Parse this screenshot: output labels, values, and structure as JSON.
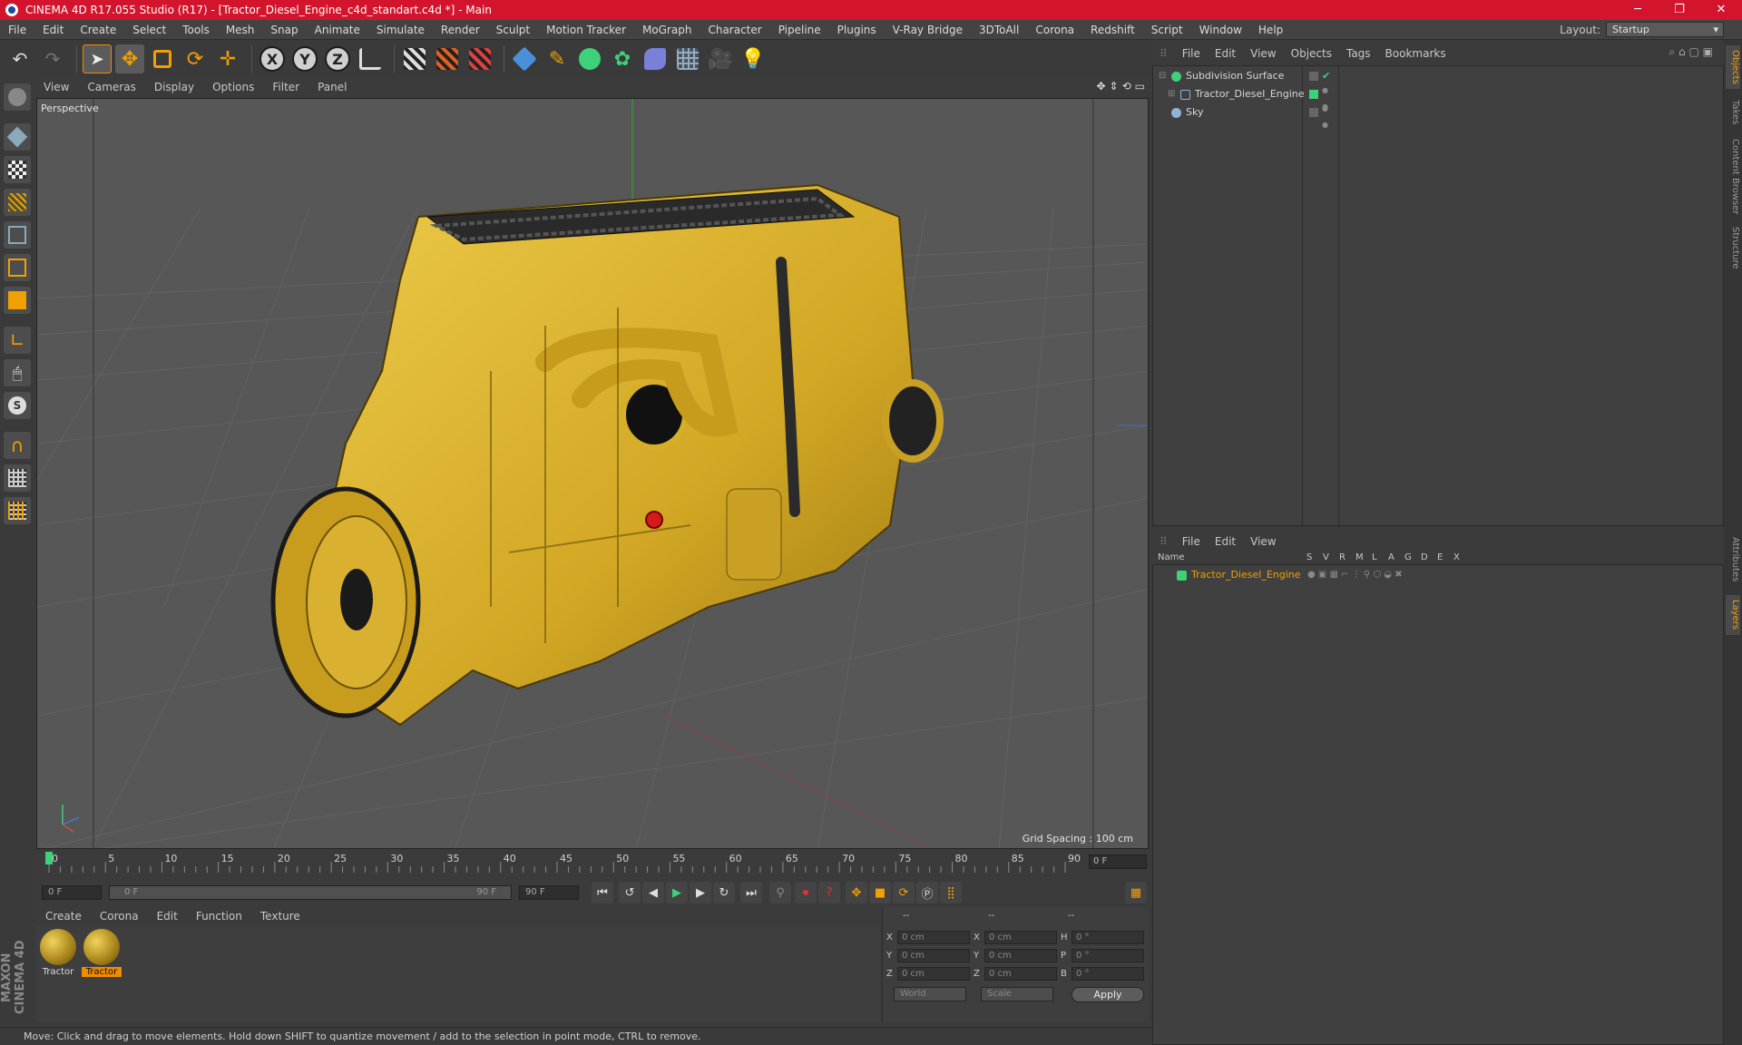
{
  "window": {
    "title": "CINEMA 4D R17.055 Studio (R17) - [Tractor_Diesel_Engine_c4d_standart.c4d *] - Main",
    "minimize": "─",
    "maximize": "❐",
    "close": "✕"
  },
  "menu": [
    "File",
    "Edit",
    "Create",
    "Select",
    "Tools",
    "Mesh",
    "Snap",
    "Animate",
    "Simulate",
    "Render",
    "Sculpt",
    "Motion Tracker",
    "MoGraph",
    "Character",
    "Pipeline",
    "Plugins",
    "V-Ray Bridge",
    "3DToAll",
    "Corona",
    "Redshift",
    "Script",
    "Window",
    "Help"
  ],
  "layout": {
    "label": "Layout:",
    "value": "Startup"
  },
  "viewport": {
    "menu": [
      "View",
      "Cameras",
      "Display",
      "Options",
      "Filter",
      "Panel"
    ],
    "camera_label": "Perspective",
    "grid_spacing": "Grid Spacing : 100 cm"
  },
  "timeline": {
    "ticks": [
      "0",
      "5",
      "10",
      "15",
      "20",
      "25",
      "30",
      "35",
      "40",
      "45",
      "50",
      "55",
      "60",
      "65",
      "70",
      "75",
      "80",
      "85",
      "90"
    ],
    "current_frame": "0 F",
    "start_field": "0 F",
    "range_start": "0 F",
    "range_end": "90 F",
    "end_field": "90 F"
  },
  "material_manager": {
    "menu": [
      "Create",
      "Corona",
      "Edit",
      "Function",
      "Texture"
    ],
    "materials": [
      {
        "label": "Tractor",
        "selected": false
      },
      {
        "label": "Tractor",
        "selected": true
      }
    ]
  },
  "coordinates": {
    "headers": [
      "--",
      "--",
      "--"
    ],
    "rows": [
      {
        "axis1": "X",
        "val1": "0 cm",
        "axis2": "X",
        "val2": "0 cm",
        "axis3": "H",
        "val3": "0 °"
      },
      {
        "axis1": "Y",
        "val1": "0 cm",
        "axis2": "Y",
        "val2": "0 cm",
        "axis3": "P",
        "val3": "0 °"
      },
      {
        "axis1": "Z",
        "val1": "0 cm",
        "axis2": "Z",
        "val2": "0 cm",
        "axis3": "B",
        "val3": "0 °"
      }
    ],
    "mode": "World",
    "transform": "Scale",
    "apply": "Apply"
  },
  "status": "Move: Click and drag to move elements. Hold down SHIFT to quantize movement / add to the selection in point mode, CTRL to remove.",
  "object_manager": {
    "menu": [
      "File",
      "Edit",
      "View",
      "Objects",
      "Tags",
      "Bookmarks"
    ],
    "objects": [
      {
        "name": "Subdivision Surface",
        "icon_color": "#3fd07a"
      },
      {
        "name": "Tractor_Diesel_Engine",
        "icon_color": "#8fb4d8"
      },
      {
        "name": "Sky",
        "icon_color": "#8fb4d8"
      }
    ]
  },
  "layer_manager": {
    "menu": [
      "File",
      "Edit",
      "View"
    ],
    "columns": [
      "Name",
      "S",
      "V",
      "R",
      "M",
      "L",
      "A",
      "G",
      "D",
      "E",
      "X"
    ],
    "layers": [
      {
        "name": "Tractor_Diesel_Engine",
        "color": "#3fd07a"
      }
    ]
  },
  "side_tabs": [
    "Objects",
    "Takes",
    "Content Browser",
    "Structure",
    "Attributes",
    "Layers"
  ],
  "brand": "MAXON CINEMA 4D",
  "colors": {
    "accent": "#f08a00",
    "titlebar": "#d2142c",
    "engine": "#e0b52a"
  }
}
